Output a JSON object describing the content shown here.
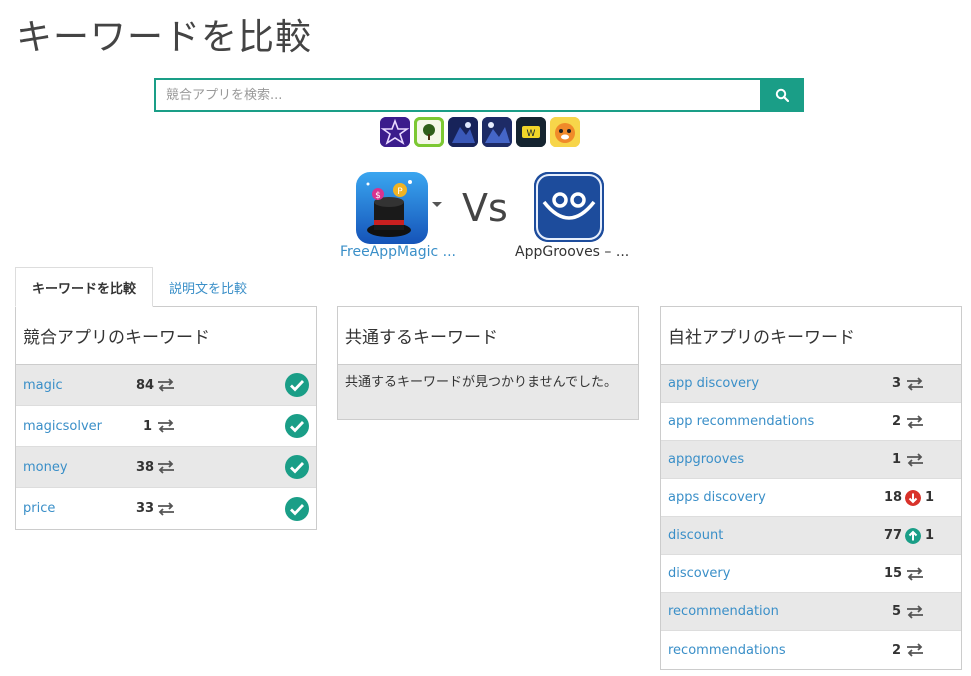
{
  "page": {
    "title": "キーワードを比較"
  },
  "search": {
    "placeholder": "競合アプリを検索..."
  },
  "suggestions": [
    "star-app-icon",
    "tree-app-icon",
    "night-app-icon-1",
    "night-app-icon-2",
    "video-app-icon",
    "tiger-app-icon"
  ],
  "apps": {
    "competitor": {
      "name": "FreeAppMagic ..."
    },
    "vs": "Vs",
    "own": {
      "name": "AppGrooves – ..."
    }
  },
  "tabs": [
    {
      "label": "キーワードを比較",
      "active": true
    },
    {
      "label": "説明文を比較",
      "active": false
    }
  ],
  "competitor_panel": {
    "title": "競合アプリのキーワード",
    "rows": [
      {
        "keyword": "magic",
        "rank": "84"
      },
      {
        "keyword": "magicsolver",
        "rank": "1"
      },
      {
        "keyword": "money",
        "rank": "38"
      },
      {
        "keyword": "price",
        "rank": "33"
      }
    ]
  },
  "common_panel": {
    "title": "共通するキーワード",
    "empty_message": "共通するキーワードが見つかりませんでした。"
  },
  "own_panel": {
    "title": "自社アプリのキーワード",
    "rows": [
      {
        "keyword": "app discovery",
        "rank": "3",
        "trend": "none",
        "change": ""
      },
      {
        "keyword": "app recommendations",
        "rank": "2",
        "trend": "none",
        "change": ""
      },
      {
        "keyword": "appgrooves",
        "rank": "1",
        "trend": "none",
        "change": ""
      },
      {
        "keyword": "apps discovery",
        "rank": "18",
        "trend": "down",
        "change": "1"
      },
      {
        "keyword": "discount",
        "rank": "77",
        "trend": "up",
        "change": "1"
      },
      {
        "keyword": "discovery",
        "rank": "15",
        "trend": "none",
        "change": ""
      },
      {
        "keyword": "recommendation",
        "rank": "5",
        "trend": "none",
        "change": ""
      },
      {
        "keyword": "recommendations",
        "rank": "2",
        "trend": "none",
        "change": ""
      }
    ]
  },
  "colors": {
    "accent": "#1a9e87",
    "link": "#3a8fc8",
    "down": "#d9322a",
    "up": "#1a9e87"
  }
}
